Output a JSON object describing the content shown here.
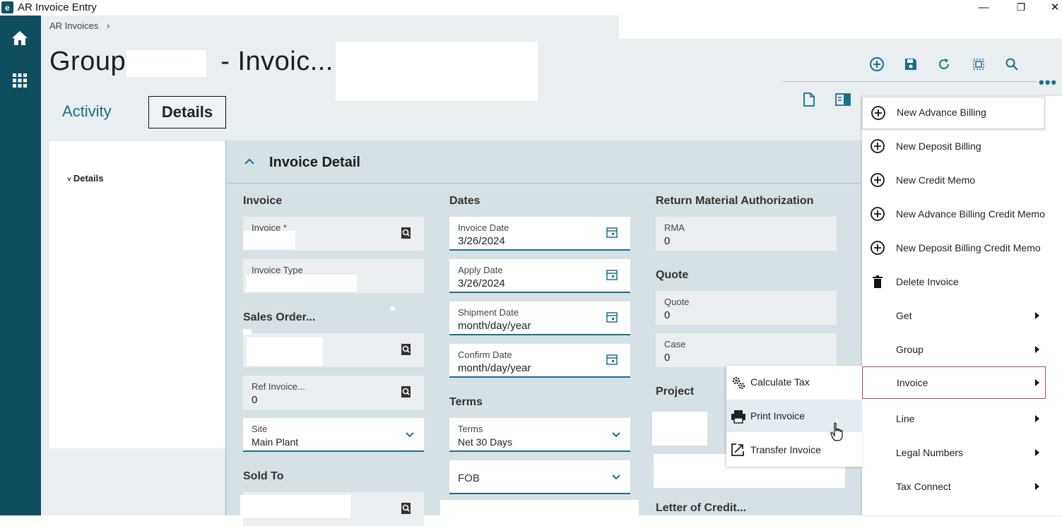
{
  "window": {
    "title": "AR Invoice Entry",
    "app_icon": "e-icon",
    "minimize": "—",
    "restore": "❐",
    "close": "✕"
  },
  "breadcrumb": {
    "text": "AR Invoices",
    "separator": "›"
  },
  "page": {
    "title_prefix": "Group",
    "title_middle": "- Invoic..."
  },
  "tabs": {
    "activity": "Activity",
    "details": "Details"
  },
  "sidebar": {
    "details": "Details"
  },
  "panel": {
    "title": "Invoice Detail"
  },
  "sections": {
    "invoice": "Invoice",
    "dates": "Dates",
    "rma_head": "Return Material Authorization",
    "quote_head": "Quote",
    "sales_order": "Sales Order...",
    "terms_head": "Terms",
    "project": "Project",
    "sold_to": "Sold To",
    "letter_of_credit": "Letter of Credit..."
  },
  "fields": {
    "invoice": {
      "label": "Invoice *",
      "value": ""
    },
    "invoice_type": {
      "label": "Invoice Type",
      "value": ""
    },
    "ref_invoice": {
      "label": "Ref Invoice...",
      "value": "0"
    },
    "site": {
      "label": "Site",
      "value": "Main Plant"
    },
    "invoice_date": {
      "label": "Invoice Date",
      "value": "3/26/2024"
    },
    "apply_date": {
      "label": "Apply Date",
      "value": "3/26/2024"
    },
    "shipment_date": {
      "label": "Shipment Date",
      "value": "month/day/year"
    },
    "confirm_date": {
      "label": "Confirm Date",
      "value": "month/day/year"
    },
    "terms": {
      "label": "Terms",
      "value": "Net 30 Days"
    },
    "fob": {
      "label": "FOB",
      "value": ""
    },
    "rma": {
      "label": "RMA",
      "value": "0"
    },
    "quote": {
      "label": "Quote",
      "value": "0"
    },
    "case": {
      "label": "Case",
      "value": "0"
    }
  },
  "menu": {
    "items": [
      {
        "label": "New Advance Billing",
        "icon": "plus-circle-icon"
      },
      {
        "label": "New Deposit Billing",
        "icon": "plus-circle-icon"
      },
      {
        "label": "New Credit Memo",
        "icon": "plus-circle-icon"
      },
      {
        "label": "New Advance Billing Credit Memo",
        "icon": "plus-circle-icon"
      },
      {
        "label": "New Deposit Billing Credit Memo",
        "icon": "plus-circle-icon"
      },
      {
        "label": "Delete Invoice",
        "icon": "trash-icon"
      },
      {
        "label": "Get",
        "icon": ""
      },
      {
        "label": "Group",
        "icon": ""
      },
      {
        "label": "Invoice",
        "icon": ""
      },
      {
        "label": "Line",
        "icon": ""
      },
      {
        "label": "Legal Numbers",
        "icon": ""
      },
      {
        "label": "Tax Connect",
        "icon": ""
      }
    ]
  },
  "submenu": {
    "items": [
      {
        "label": "Calculate Tax",
        "icon": "gears-icon"
      },
      {
        "label": "Print Invoice",
        "icon": "printer-icon"
      },
      {
        "label": "Transfer Invoice",
        "icon": "transfer-icon"
      }
    ]
  },
  "colors": {
    "nav": "#0e4e5e",
    "accent": "#1b6f8a",
    "highlight_border": "#b5437a"
  }
}
